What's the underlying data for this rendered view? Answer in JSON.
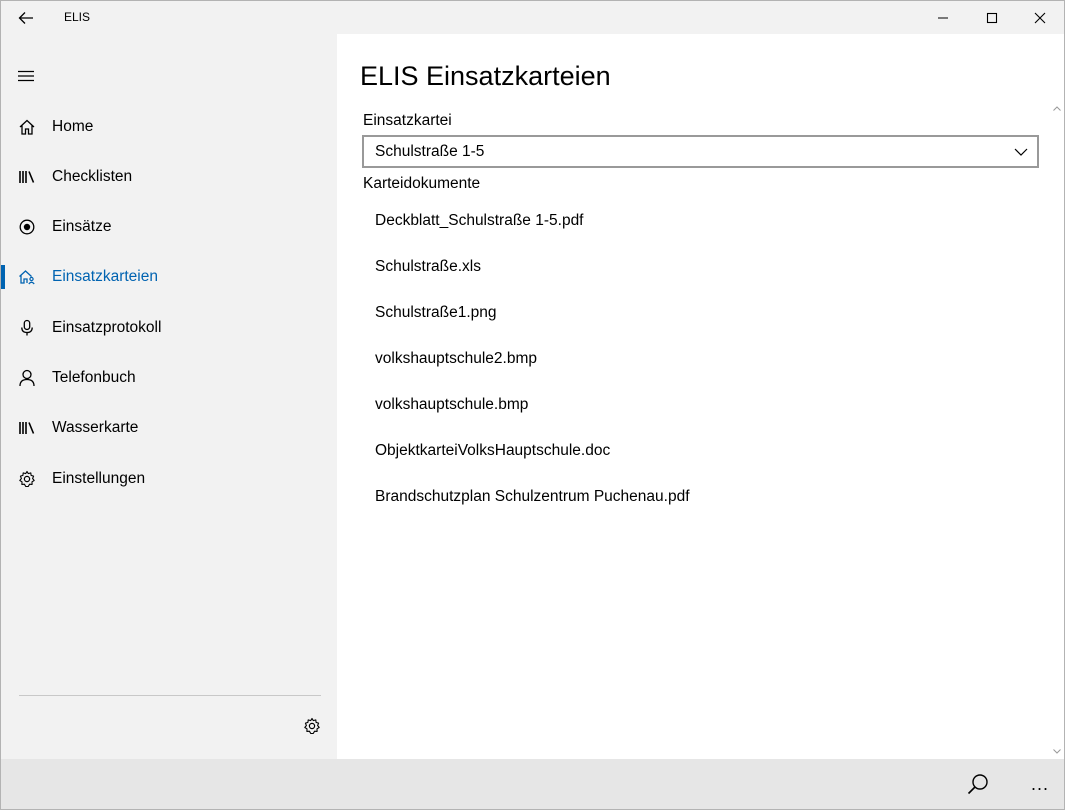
{
  "window": {
    "title": "ELIS"
  },
  "sidebar": {
    "items": [
      {
        "label": "Home",
        "icon": "home-icon"
      },
      {
        "label": "Checklisten",
        "icon": "library-icon"
      },
      {
        "label": "Einsätze",
        "icon": "radio-target-icon"
      },
      {
        "label": "Einsatzkarteien",
        "icon": "house-people-icon",
        "selected": true
      },
      {
        "label": "Einsatzprotokoll",
        "icon": "microphone-icon"
      },
      {
        "label": "Telefonbuch",
        "icon": "person-icon"
      },
      {
        "label": "Wasserkarte",
        "icon": "library-icon"
      },
      {
        "label": "Einstellungen",
        "icon": "gear-icon"
      }
    ]
  },
  "main": {
    "title": "ELIS Einsatzkarteien",
    "combo_label": "Einsatzkartei",
    "combo_value": "Schulstraße 1-5",
    "docs_label": "Karteidokumente",
    "documents": [
      "Deckblatt_Schulstraße 1-5.pdf",
      "Schulstraße.xls",
      "Schulstraße1.png",
      "volkshauptschule2.bmp",
      "volkshauptschule.bmp",
      "ObjektkarteiVolksHauptschule.doc",
      "Brandschutzplan Schulzentrum Puchenau.pdf"
    ]
  },
  "appbar": {
    "more_label": "..."
  },
  "colors": {
    "accent": "#0063b1",
    "sidebar_bg": "#f2f2f2",
    "appbar_bg": "#e6e6e6"
  }
}
